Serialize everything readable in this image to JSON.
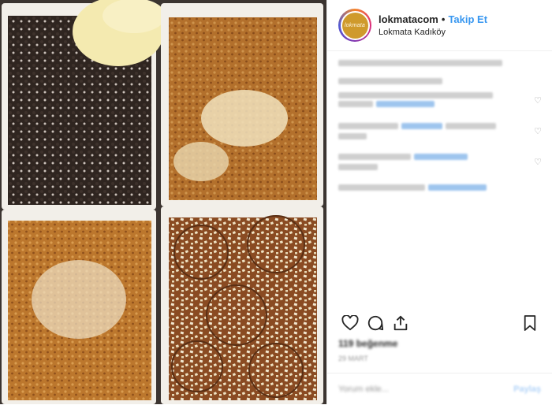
{
  "post": {
    "username": "lokmatacom",
    "separator": "•",
    "follow_label": "Takip Et",
    "location": "Lokmata Kadıköy",
    "avatar_text": "lokmata",
    "photo_alt": "Four boxes of lokma desserts with ice cream, cookie crumbs and nuts"
  },
  "caption": {
    "text": "lokmatacom Çıtır ve nefis lokmalar"
  },
  "comments": [
    {
      "text": "blurred comment"
    },
    {
      "text": "blurred comment"
    },
    {
      "text": "blurred comment"
    },
    {
      "text": "blurred comment"
    }
  ],
  "likes": {
    "text": "119 beğenme"
  },
  "time": {
    "text": "29 Mart"
  },
  "add_comment": {
    "placeholder": "Yorum ekle...",
    "post_label": "Paylaş"
  },
  "icons": {
    "like": "heart-icon",
    "comment": "comment-icon",
    "share": "share-icon",
    "save": "bookmark-icon"
  },
  "colors": {
    "follow": "#3897f0",
    "text": "#262626",
    "muted": "#8e8e8e"
  }
}
